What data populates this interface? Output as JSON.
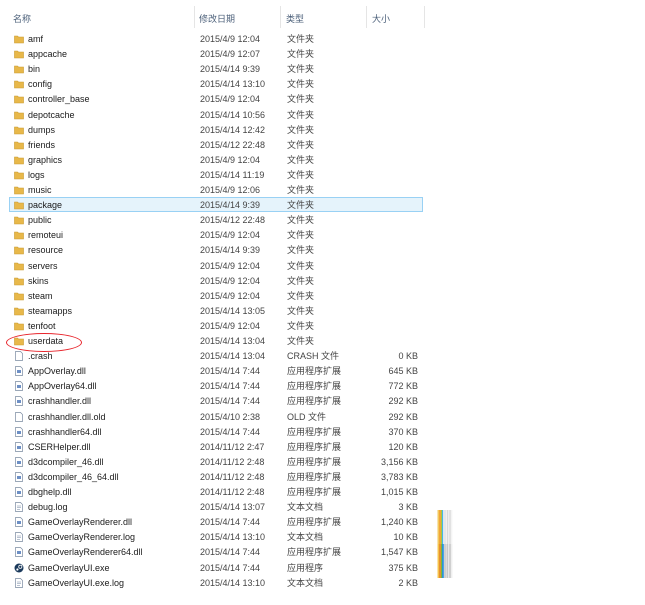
{
  "header": {
    "name": "名称",
    "date": "修改日期",
    "type": "类型",
    "size": "大小"
  },
  "files": [
    {
      "name": "amf",
      "date": "2015/4/9 12:04",
      "type": "文件夹",
      "size": "",
      "icon": "folder-icon"
    },
    {
      "name": "appcache",
      "date": "2015/4/9 12:07",
      "type": "文件夹",
      "size": "",
      "icon": "folder-icon"
    },
    {
      "name": "bin",
      "date": "2015/4/14 9:39",
      "type": "文件夹",
      "size": "",
      "icon": "folder-icon"
    },
    {
      "name": "config",
      "date": "2015/4/14 13:10",
      "type": "文件夹",
      "size": "",
      "icon": "folder-icon"
    },
    {
      "name": "controller_base",
      "date": "2015/4/9 12:04",
      "type": "文件夹",
      "size": "",
      "icon": "folder-icon"
    },
    {
      "name": "depotcache",
      "date": "2015/4/14 10:56",
      "type": "文件夹",
      "size": "",
      "icon": "folder-icon"
    },
    {
      "name": "dumps",
      "date": "2015/4/14 12:42",
      "type": "文件夹",
      "size": "",
      "icon": "folder-icon"
    },
    {
      "name": "friends",
      "date": "2015/4/12 22:48",
      "type": "文件夹",
      "size": "",
      "icon": "folder-icon"
    },
    {
      "name": "graphics",
      "date": "2015/4/9 12:04",
      "type": "文件夹",
      "size": "",
      "icon": "folder-icon"
    },
    {
      "name": "logs",
      "date": "2015/4/14 11:19",
      "type": "文件夹",
      "size": "",
      "icon": "folder-icon"
    },
    {
      "name": "music",
      "date": "2015/4/9 12:06",
      "type": "文件夹",
      "size": "",
      "icon": "folder-icon"
    },
    {
      "name": "package",
      "date": "2015/4/14 9:39",
      "type": "文件夹",
      "size": "",
      "icon": "folder-icon"
    },
    {
      "name": "public",
      "date": "2015/4/12 22:48",
      "type": "文件夹",
      "size": "",
      "icon": "folder-icon"
    },
    {
      "name": "remoteui",
      "date": "2015/4/9 12:04",
      "type": "文件夹",
      "size": "",
      "icon": "folder-icon"
    },
    {
      "name": "resource",
      "date": "2015/4/14 9:39",
      "type": "文件夹",
      "size": "",
      "icon": "folder-icon"
    },
    {
      "name": "servers",
      "date": "2015/4/9 12:04",
      "type": "文件夹",
      "size": "",
      "icon": "folder-icon"
    },
    {
      "name": "skins",
      "date": "2015/4/9 12:04",
      "type": "文件夹",
      "size": "",
      "icon": "folder-icon"
    },
    {
      "name": "steam",
      "date": "2015/4/9 12:04",
      "type": "文件夹",
      "size": "",
      "icon": "folder-icon"
    },
    {
      "name": "steamapps",
      "date": "2015/4/14 13:05",
      "type": "文件夹",
      "size": "",
      "icon": "folder-icon"
    },
    {
      "name": "tenfoot",
      "date": "2015/4/9 12:04",
      "type": "文件夹",
      "size": "",
      "icon": "folder-icon"
    },
    {
      "name": "userdata",
      "date": "2015/4/14 13:04",
      "type": "文件夹",
      "size": "",
      "icon": "folder-icon"
    },
    {
      "name": ".crash",
      "date": "2015/4/14 13:04",
      "type": "CRASH 文件",
      "size": "0 KB",
      "icon": "file-icon"
    },
    {
      "name": "AppOverlay.dll",
      "date": "2015/4/14 7:44",
      "type": "应用程序扩展",
      "size": "645 KB",
      "icon": "dll-icon"
    },
    {
      "name": "AppOverlay64.dll",
      "date": "2015/4/14 7:44",
      "type": "应用程序扩展",
      "size": "772 KB",
      "icon": "dll-icon"
    },
    {
      "name": "crashhandler.dll",
      "date": "2015/4/14 7:44",
      "type": "应用程序扩展",
      "size": "292 KB",
      "icon": "dll-icon"
    },
    {
      "name": "crashhandler.dll.old",
      "date": "2015/4/10 2:38",
      "type": "OLD 文件",
      "size": "292 KB",
      "icon": "file-icon"
    },
    {
      "name": "crashhandler64.dll",
      "date": "2015/4/14 7:44",
      "type": "应用程序扩展",
      "size": "370 KB",
      "icon": "dll-icon"
    },
    {
      "name": "CSERHelper.dll",
      "date": "2014/11/12 2:47",
      "type": "应用程序扩展",
      "size": "120 KB",
      "icon": "dll-icon"
    },
    {
      "name": "d3dcompiler_46.dll",
      "date": "2014/11/12 2:48",
      "type": "应用程序扩展",
      "size": "3,156 KB",
      "icon": "dll-icon"
    },
    {
      "name": "d3dcompiler_46_64.dll",
      "date": "2014/11/12 2:48",
      "type": "应用程序扩展",
      "size": "3,783 KB",
      "icon": "dll-icon"
    },
    {
      "name": "dbghelp.dll",
      "date": "2014/11/12 2:48",
      "type": "应用程序扩展",
      "size": "1,015 KB",
      "icon": "dll-icon"
    },
    {
      "name": "debug.log",
      "date": "2015/4/14 13:07",
      "type": "文本文档",
      "size": "3 KB",
      "icon": "text-file-icon"
    },
    {
      "name": "GameOverlayRenderer.dll",
      "date": "2015/4/14 7:44",
      "type": "应用程序扩展",
      "size": "1,240 KB",
      "icon": "dll-icon"
    },
    {
      "name": "GameOverlayRenderer.log",
      "date": "2015/4/14 13:10",
      "type": "文本文档",
      "size": "10 KB",
      "icon": "text-file-icon"
    },
    {
      "name": "GameOverlayRenderer64.dll",
      "date": "2015/4/14 7:44",
      "type": "应用程序扩展",
      "size": "1,547 KB",
      "icon": "dll-icon"
    },
    {
      "name": "GameOverlayUI.exe",
      "date": "2015/4/14 7:44",
      "type": "应用程序",
      "size": "375 KB",
      "icon": "steam-icon"
    },
    {
      "name": "GameOverlayUI.exe.log",
      "date": "2015/4/14 13:10",
      "type": "文本文档",
      "size": "2 KB",
      "icon": "text-file-icon"
    }
  ],
  "selected_index": 11,
  "highlighted_index": 20,
  "colors": {
    "folder": "#e8b84a",
    "folder_dark": "#c99a2e",
    "selection_bg": "#e5f3fb",
    "selection_border": "#99d1f4",
    "annotation": "#e8242b",
    "header_text": "#4c607a"
  }
}
